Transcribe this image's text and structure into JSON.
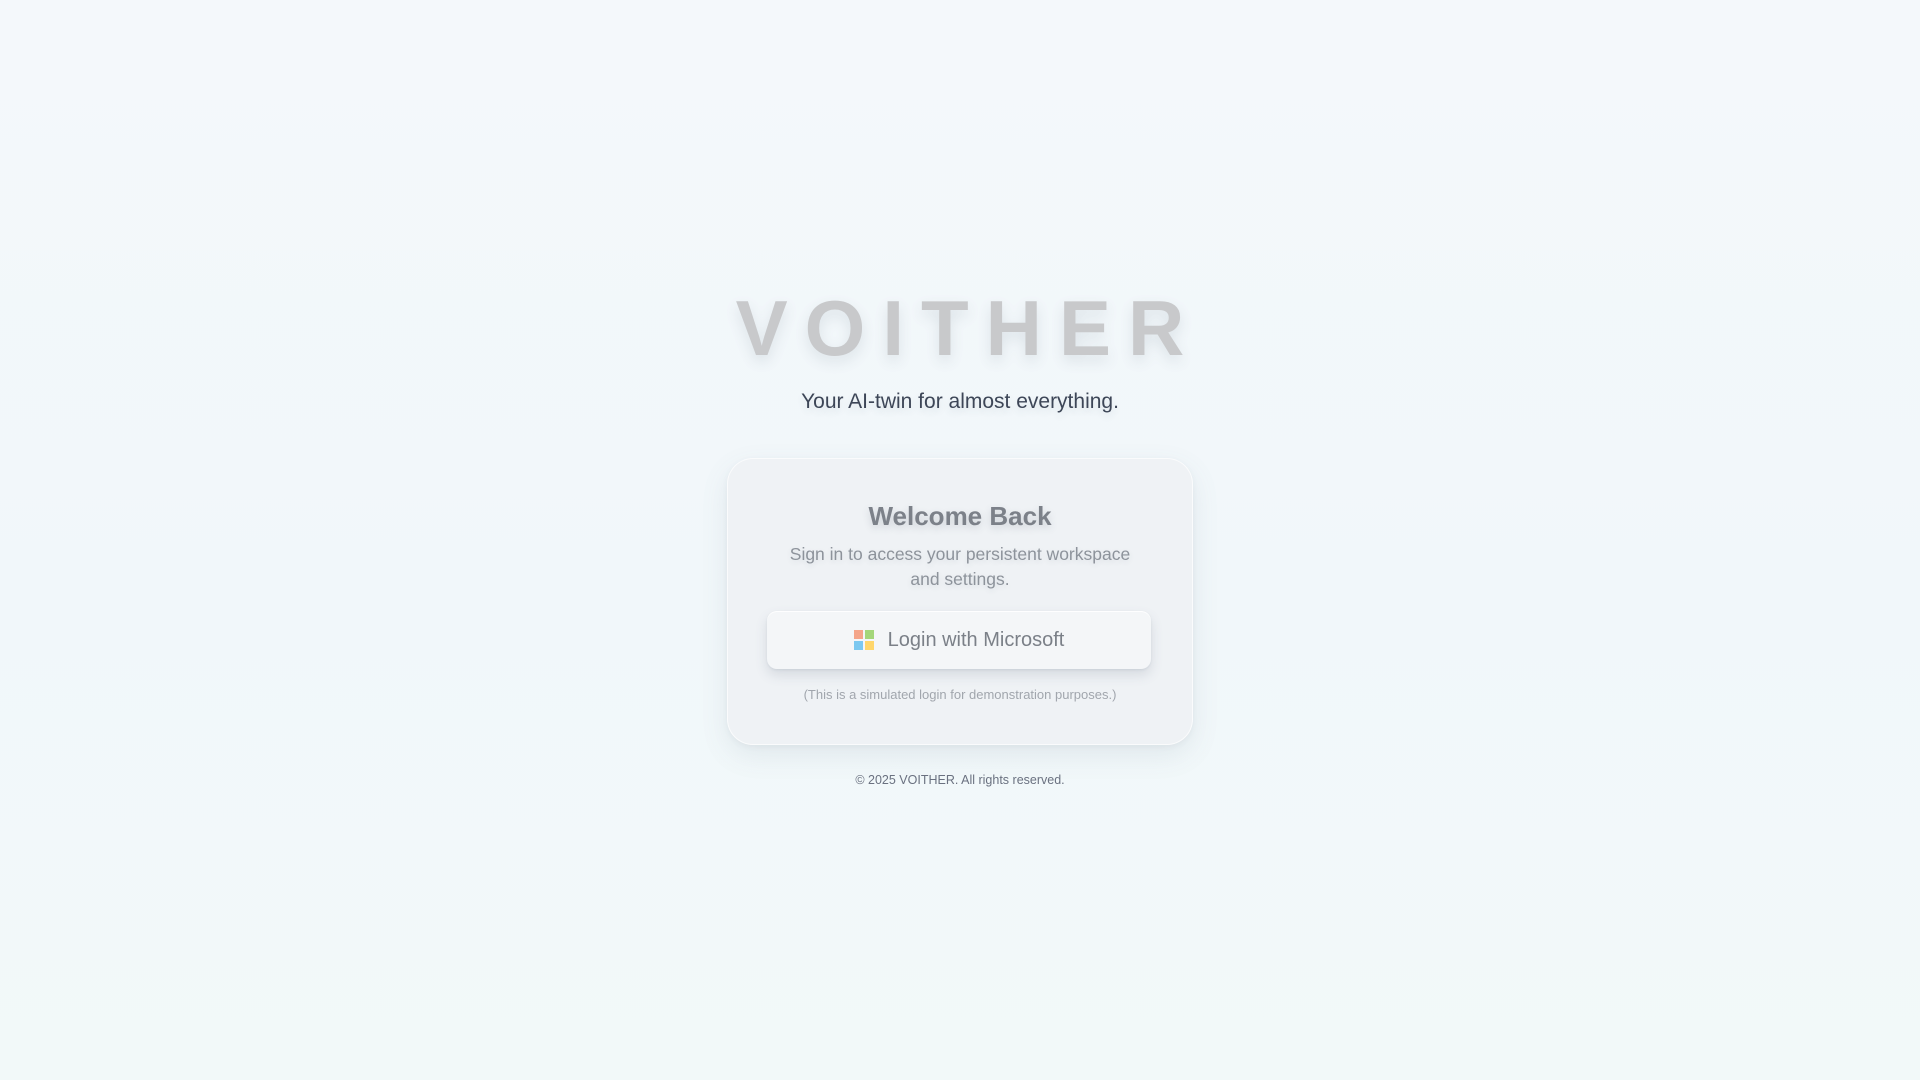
{
  "brand": {
    "title": "VOITHER",
    "tagline": "Your AI-twin for almost everything."
  },
  "login_card": {
    "title": "Welcome Back",
    "subtitle": "Sign in to access your persistent workspace and settings.",
    "login_button": {
      "label": "Login with Microsoft",
      "icon": "microsoft-logo-icon"
    },
    "disclaimer": "(This is a simulated login for demonstration purposes.)"
  },
  "footer": {
    "copyright": "© 2025 VOITHER. All rights reserved."
  },
  "colors": {
    "background": "#f3f8fb",
    "card_background": "#eff2f5",
    "ms_red": "#f4a58a",
    "ms_green": "#a4d67a",
    "ms_blue": "#7cc8f0",
    "ms_yellow": "#ffd66b"
  }
}
